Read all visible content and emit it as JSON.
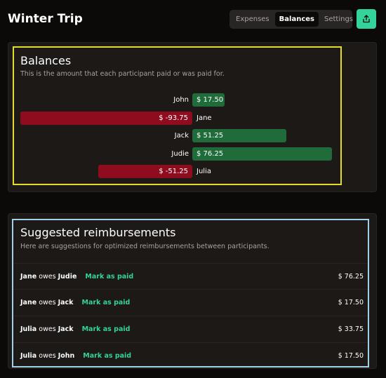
{
  "header": {
    "title": "Winter Trip"
  },
  "tabs": [
    {
      "label": "Expenses",
      "active": false
    },
    {
      "label": "Balances",
      "active": true
    },
    {
      "label": "Settings",
      "active": false
    }
  ],
  "share": {
    "icon": "share-icon"
  },
  "balances": {
    "title": "Balances",
    "description": "This is the amount that each participant paid or was paid for.",
    "items": [
      {
        "name": "John",
        "label": "$ 17.50",
        "value": 17.5
      },
      {
        "name": "Jane",
        "label": "$ -93.75",
        "value": -93.75
      },
      {
        "name": "Jack",
        "label": "$ 51.25",
        "value": 51.25
      },
      {
        "name": "Judie",
        "label": "$ 76.25",
        "value": 76.25
      },
      {
        "name": "Julia",
        "label": "$ -51.25",
        "value": -51.25
      }
    ]
  },
  "reimbursements": {
    "title": "Suggested reimbursements",
    "description": "Here are suggestions for optimized reimbursements between participants.",
    "mark_label": "Mark as paid",
    "items": [
      {
        "from": "Jane",
        "verb": "owes",
        "to": "Judie",
        "amount": "$ 76.25"
      },
      {
        "from": "Jane",
        "verb": "owes",
        "to": "Jack",
        "amount": "$ 17.50"
      },
      {
        "from": "Julia",
        "verb": "owes",
        "to": "Jack",
        "amount": "$ 33.75"
      },
      {
        "from": "Julia",
        "verb": "owes",
        "to": "John",
        "amount": "$ 17.50"
      }
    ]
  },
  "colors": {
    "background": "#0c0a09",
    "card": "#1c1917",
    "accent": "#34d399",
    "positive": "#1f6b3a",
    "negative": "#8f0c1e"
  }
}
